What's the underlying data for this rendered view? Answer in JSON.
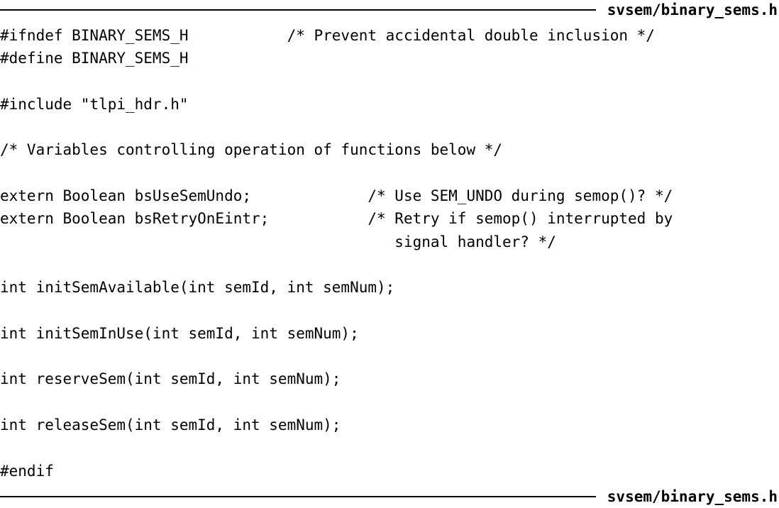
{
  "listing": {
    "filename": "svsem/binary_sems.h",
    "lines": [
      "#ifndef BINARY_SEMS_H           /* Prevent accidental double inclusion */",
      "#define BINARY_SEMS_H",
      "",
      "#include \"tlpi_hdr.h\"",
      "",
      "/* Variables controlling operation of functions below */",
      "",
      "extern Boolean bsUseSemUndo;             /* Use SEM_UNDO during semop()? */",
      "extern Boolean bsRetryOnEintr;           /* Retry if semop() interrupted by",
      "                                            signal handler? */",
      "",
      "int initSemAvailable(int semId, int semNum);",
      "",
      "int initSemInUse(int semId, int semNum);",
      "",
      "int reserveSem(int semId, int semNum);",
      "",
      "int releaseSem(int semId, int semNum);",
      "",
      "#endif"
    ]
  }
}
